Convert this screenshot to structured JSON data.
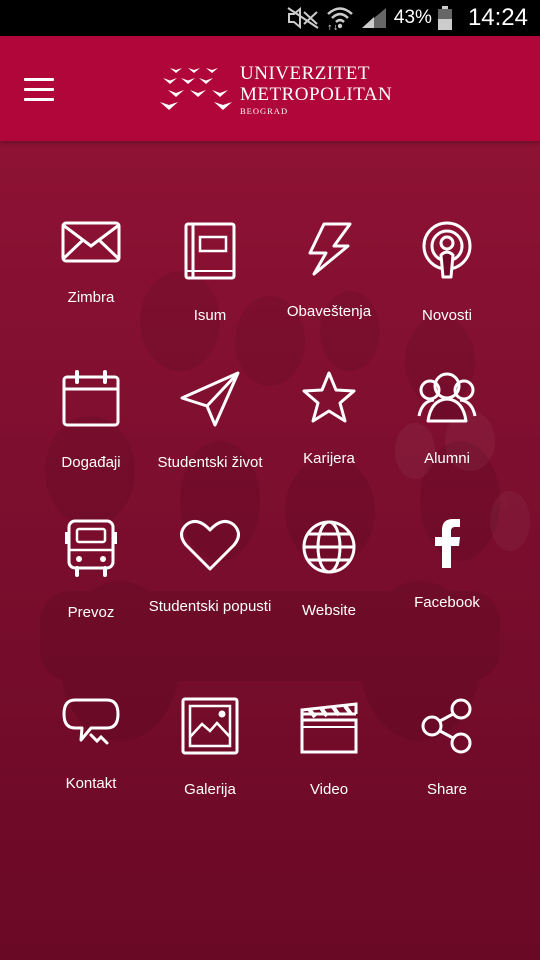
{
  "status_bar": {
    "battery_percent": "43%",
    "time": "14:24",
    "icons": [
      "mute-icon",
      "wifi-icon",
      "signal-icon",
      "battery-icon"
    ]
  },
  "header": {
    "menu_icon": "hamburger-menu-icon",
    "logo": {
      "line1": "UNIVERZITET",
      "line2": "METROPOLITAN",
      "line3": "BEOGRAD"
    }
  },
  "tiles": [
    {
      "label": "Zimbra",
      "icon": "envelope-icon"
    },
    {
      "label": "Isum",
      "icon": "book-icon"
    },
    {
      "label": "Obaveštenja",
      "icon": "lightning-icon"
    },
    {
      "label": "Novosti",
      "icon": "podcast-icon"
    },
    {
      "label": "Događaji",
      "icon": "calendar-icon"
    },
    {
      "label": "Studentski život",
      "icon": "paper-plane-icon"
    },
    {
      "label": "Karijera",
      "icon": "star-icon"
    },
    {
      "label": "Alumni",
      "icon": "group-icon"
    },
    {
      "label": "Prevoz",
      "icon": "bus-icon"
    },
    {
      "label": "Studentski popusti",
      "icon": "heart-icon"
    },
    {
      "label": "Website",
      "icon": "globe-icon"
    },
    {
      "label": "Facebook",
      "icon": "facebook-icon"
    },
    {
      "label": "Kontakt",
      "icon": "speech-bubble-icon"
    },
    {
      "label": "Galerija",
      "icon": "picture-icon"
    },
    {
      "label": "Video",
      "icon": "clapperboard-icon"
    },
    {
      "label": "Share",
      "icon": "share-icon"
    }
  ]
}
